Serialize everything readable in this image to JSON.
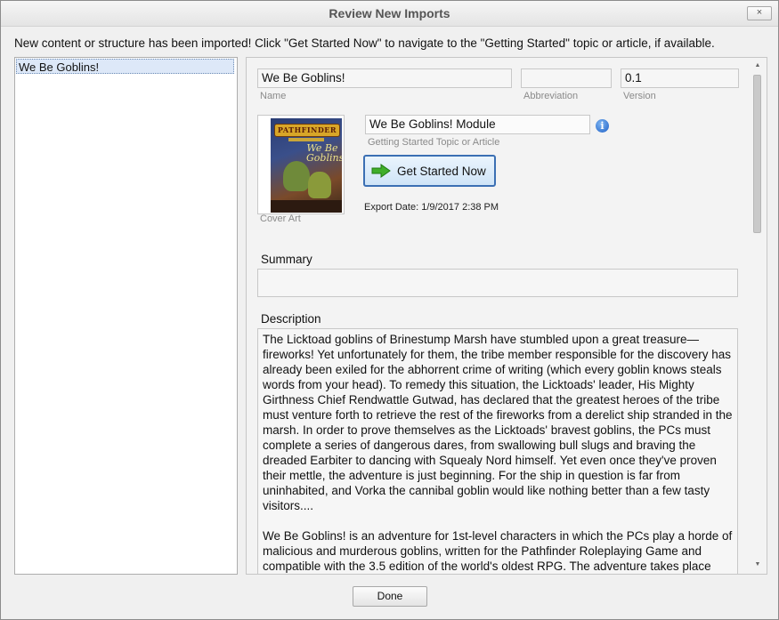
{
  "window": {
    "title": "Review New Imports",
    "close_label": "×"
  },
  "intro_text": "New content or structure has been imported! Click \"Get Started Now\" to navigate to the \"Getting Started\" topic or article, if available.",
  "import_list": {
    "items": [
      {
        "label": "We Be Goblins!",
        "selected": true
      }
    ]
  },
  "details": {
    "name": {
      "value": "We Be Goblins!",
      "caption": "Name"
    },
    "abbreviation": {
      "value": "",
      "caption": "Abbreviation"
    },
    "version": {
      "value": "0.1",
      "caption": "Version"
    },
    "cover_art": {
      "caption": "Cover Art",
      "logo_text": "PATHFINDER",
      "title_text": "We Be Goblins!"
    },
    "getting_started": {
      "value": "We Be Goblins! Module",
      "caption": "Getting Started Topic or Article"
    },
    "get_started_button": "Get Started Now",
    "export_date": "Export Date: 1/9/2017 2:38 PM",
    "summary_label": "Summary",
    "summary_value": "",
    "description_label": "Description",
    "description_paragraphs": [
      "The Licktoad goblins of Brinestump Marsh have stumbled upon a great treasure—fireworks! Yet unfortunately for them, the tribe member responsible for the discovery has already been exiled for the abhorrent crime of writing (which every goblin knows steals words from your head). To remedy this situation, the Licktoads' leader, His Mighty Girthness Chief Rendwattle Gutwad, has declared that the greatest heroes of the tribe must venture forth to retrieve the rest of the fireworks from a derelict ship stranded in the marsh. In order to prove themselves as the Licktoads' bravest goblins, the PCs must complete a series of dangerous dares, from swallowing bull slugs and braving the dreaded Earbiter to dancing with Squealy Nord himself. Yet even once they've proven their mettle, the adventure is just beginning. For the ship in question is far from uninhabited, and Vorka the cannibal goblin would like nothing better than a few tasty visitors....",
      "We Be Goblins! is an adventure for 1st-level characters in which the PCs play a horde of malicious and murderous goblins, written for the Pathfinder Roleplaying Game and compatible with the 3.5 edition of the world's oldest RPG. The adventure takes place"
    ]
  },
  "footer": {
    "done_label": "Done"
  },
  "colors": {
    "selection_bg": "#dde8f8",
    "button_border": "#3b6fb3",
    "info_icon": "#1d5fc6",
    "arrow_icon": "#3fae2a"
  }
}
